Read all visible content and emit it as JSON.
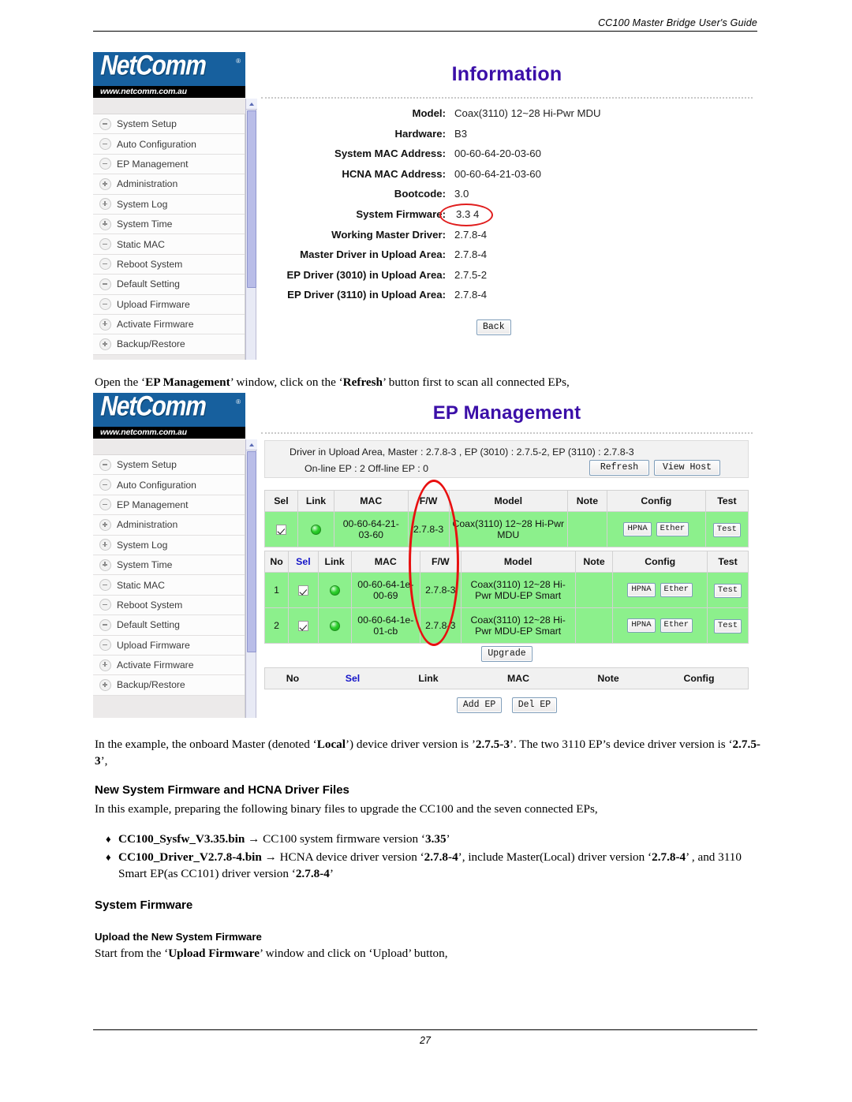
{
  "document": {
    "header_title": "CC100 Master Bridge User's Guide",
    "page_number": "27"
  },
  "screenshot_information": {
    "brand": {
      "name": "NetComm",
      "registered_mark": "®",
      "url": "www.netcomm.com.au"
    },
    "panel_title": "Information",
    "sidebar": {
      "items": [
        {
          "label": "System Setup",
          "icon": "minus-node-icon",
          "state": "minus"
        },
        {
          "label": "Auto Configuration",
          "icon": "minus-node-icon",
          "state": "minus"
        },
        {
          "label": "EP Management",
          "icon": "minus-node-icon",
          "state": "minus"
        },
        {
          "label": "Administration",
          "icon": "plus-node-icon",
          "state": "plus"
        },
        {
          "label": "System Log",
          "icon": "plus-node-icon",
          "state": "plus"
        },
        {
          "label": "System Time",
          "icon": "plus-node-icon",
          "state": "plus"
        },
        {
          "label": "Static MAC",
          "icon": "minus-node-icon",
          "state": "minus"
        },
        {
          "label": "Reboot System",
          "icon": "minus-node-icon",
          "state": "minus"
        },
        {
          "label": "Default Setting",
          "icon": "minus-node-icon",
          "state": "minus"
        },
        {
          "label": "Upload Firmware",
          "icon": "minus-node-icon",
          "state": "minus"
        },
        {
          "label": "Activate Firmware",
          "icon": "plus-node-icon",
          "state": "plus"
        },
        {
          "label": "Backup/Restore",
          "icon": "plus-node-icon",
          "state": "plus"
        }
      ]
    },
    "fields": [
      {
        "key": "Model:",
        "value": "Coax(3110) 12~28 Hi-Pwr MDU"
      },
      {
        "key": "Hardware:",
        "value": "B3"
      },
      {
        "key": "System MAC Address:",
        "value": "00-60-64-20-03-60"
      },
      {
        "key": "HCNA MAC Address:",
        "value": "00-60-64-21-03-60"
      },
      {
        "key": "Bootcode:",
        "value": "3.0"
      },
      {
        "key": "System Firmware:",
        "value": "3.3 4",
        "highlighted": true
      },
      {
        "key": "Working Master Driver:",
        "value": "2.7.8-4"
      },
      {
        "key": "Master Driver in Upload Area:",
        "value": "2.7.8-4"
      },
      {
        "key": "EP Driver (3010) in Upload Area:",
        "value": "2.7.5-2"
      },
      {
        "key": "EP Driver (3110) in Upload Area:",
        "value": "2.7.8-4"
      }
    ],
    "back_button": "Back",
    "annotation_color": "#e01d1d"
  },
  "paragraph_1": {
    "parts": [
      {
        "text": "Open the ‘",
        "bold": false
      },
      {
        "text": "EP Management",
        "bold": true
      },
      {
        "text": "’ window, click on the ‘",
        "bold": false
      },
      {
        "text": "Refresh",
        "bold": true
      },
      {
        "text": "’ button first to scan all connected EPs,",
        "bold": false
      }
    ]
  },
  "screenshot_ep_management": {
    "brand": {
      "name": "NetComm",
      "registered_mark": "®",
      "url": "www.netcomm.com.au"
    },
    "panel_title": "EP Management",
    "sidebar": {
      "items": [
        {
          "label": "System Setup",
          "state": "minus"
        },
        {
          "label": "Auto Configuration",
          "state": "minus"
        },
        {
          "label": "EP Management",
          "state": "minus"
        },
        {
          "label": "Administration",
          "state": "plus"
        },
        {
          "label": "System Log",
          "state": "plus"
        },
        {
          "label": "System Time",
          "state": "plus"
        },
        {
          "label": "Static MAC",
          "state": "minus"
        },
        {
          "label": "Reboot System",
          "state": "minus"
        },
        {
          "label": "Default Setting",
          "state": "minus"
        },
        {
          "label": "Upload Firmware",
          "state": "minus"
        },
        {
          "label": "Activate Firmware",
          "state": "plus"
        },
        {
          "label": "Backup/Restore",
          "state": "plus"
        }
      ]
    },
    "status": {
      "driver_line": "Driver in Upload Area, Master : 2.7.8-3 ,  EP (3010) : 2.7.5-2,  EP (3110) : 2.7.8-3",
      "counts_line": "On-line EP : 2   Off-line EP : 0",
      "refresh_button": "Refresh",
      "view_host_button": "View Host"
    },
    "master_table": {
      "headers": [
        "Sel",
        "Link",
        "MAC",
        "F/W",
        "Model",
        "Note",
        "Config",
        "Test"
      ],
      "rows": [
        {
          "sel": true,
          "link": "online",
          "mac": "00-60-64-21-03-60",
          "fw": "2.7.8-3",
          "model": "Coax(3110) 12~28 Hi-Pwr MDU",
          "note": "",
          "config": [
            "HPNA",
            "Ether"
          ],
          "test": "Test"
        }
      ]
    },
    "ep_table": {
      "headers": [
        "No",
        "Sel",
        "Link",
        "MAC",
        "F/W",
        "Model",
        "Note",
        "Config",
        "Test"
      ],
      "rows": [
        {
          "no": "1",
          "sel": true,
          "link": "online",
          "mac": "00-60-64-1e-00-69",
          "fw": "2.7.8-3",
          "model": "Coax(3110) 12~28 Hi-Pwr MDU-EP Smart",
          "note": "",
          "config": [
            "HPNA",
            "Ether"
          ],
          "test": "Test"
        },
        {
          "no": "2",
          "sel": true,
          "link": "online",
          "mac": "00-60-64-1e-01-cb",
          "fw": "2.7.8-3",
          "model": "Coax(3110) 12~28 Hi-Pwr MDU-EP Smart",
          "note": "",
          "config": [
            "HPNA",
            "Ether"
          ],
          "test": "Test"
        }
      ]
    },
    "upgrade_button": "Upgrade",
    "offline_table": {
      "headers": [
        "No",
        "Sel",
        "Link",
        "MAC",
        "Note",
        "Config"
      ],
      "rows": []
    },
    "add_ep_button": "Add EP",
    "del_ep_button": "Del EP",
    "annotation_color": "#e81010"
  },
  "paragraph_2": {
    "parts": [
      {
        "text": "In the example, the onboard Master (denoted ‘",
        "bold": false
      },
      {
        "text": "Local",
        "bold": true
      },
      {
        "text": "’) device driver version is ’",
        "bold": false
      },
      {
        "text": "2.7.5-3",
        "bold": true
      },
      {
        "text": "’. The two 3110 EP’s device driver version is ‘",
        "bold": false
      },
      {
        "text": "2.7.5-3",
        "bold": true
      },
      {
        "text": "’,",
        "bold": false
      }
    ]
  },
  "heading_new_firmware": "New System Firmware and HCNA Driver Files",
  "paragraph_3": {
    "parts": [
      {
        "text": "In this example, preparing the following binary files to upgrade the CC100 and the seven connected EPs,",
        "bold": false
      }
    ]
  },
  "bullets": [
    {
      "mark": "♦",
      "parts": [
        {
          "text": "CC100_Sysfw_V3.35.bin",
          "bold": true
        },
        {
          "text": " → CC100 system firmware version ‘",
          "bold": false
        },
        {
          "text": "3.35",
          "bold": true
        },
        {
          "text": "’",
          "bold": false
        }
      ]
    },
    {
      "mark": "♦",
      "parts": [
        {
          "text": "CC100_Driver_V2.7.8-4.bin",
          "bold": true
        },
        {
          "text": " → HCNA device driver version ‘",
          "bold": false
        },
        {
          "text": "2.7.8-4",
          "bold": true
        },
        {
          "text": "’, include Master(Local) driver version ‘",
          "bold": false
        },
        {
          "text": "2.7.8-4",
          "bold": true
        },
        {
          "text": "’ , and 3110 Smart EP(as CC101) driver version ‘",
          "bold": false
        },
        {
          "text": "2.7.8-4",
          "bold": true
        },
        {
          "text": "’",
          "bold": false
        }
      ]
    }
  ],
  "heading_system_firmware": "System Firmware",
  "heading_upload_firmware": "Upload the New System Firmware",
  "paragraph_4": {
    "parts": [
      {
        "text": "Start from the ‘",
        "bold": false
      },
      {
        "text": "Upload Firmware",
        "bold": true
      },
      {
        "text": "’ window and click on ‘Upload’ button,",
        "bold": false
      }
    ]
  }
}
